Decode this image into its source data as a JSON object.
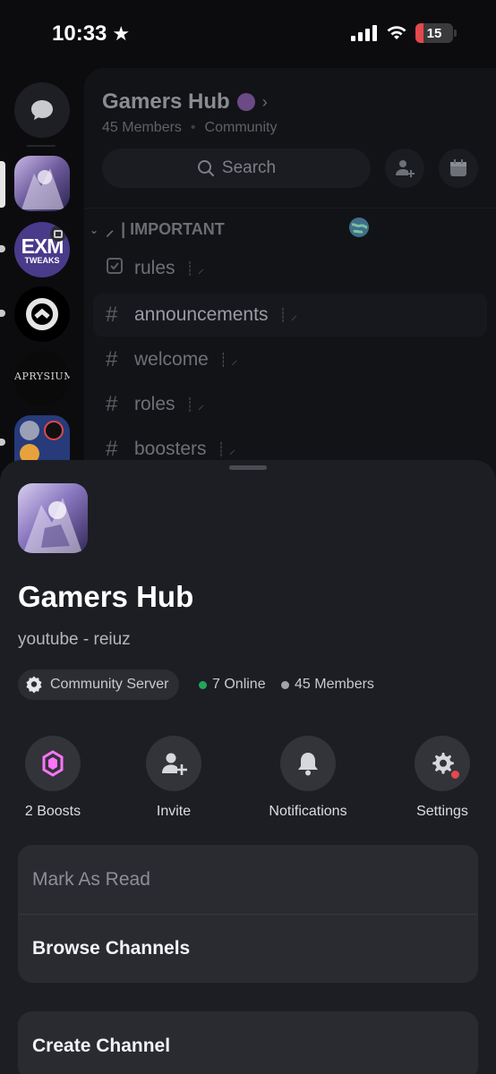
{
  "status_bar": {
    "time": "10:33",
    "star": "★",
    "battery": "15"
  },
  "server": {
    "name": "Gamers Hub",
    "members_short": "45 Members",
    "type": "Community",
    "description": "youtube - reiuz",
    "community_chip": "Community Server",
    "online": "7 Online",
    "members": "45 Members"
  },
  "panel": {
    "search_label": "Search",
    "category": "| IMPORTANT",
    "channels": [
      {
        "name": "rules"
      },
      {
        "name": "announcements"
      },
      {
        "name": "welcome"
      },
      {
        "name": "roles"
      },
      {
        "name": "boosters"
      }
    ]
  },
  "rail": {
    "servers": [
      "Gamers Hub",
      "EXM Tweaks",
      "Server 3",
      "Server 4",
      "Server folder"
    ],
    "exm_text_top": "EXM",
    "exm_text_bottom": "TWEAKS",
    "fourth_text": "APRYSIUM"
  },
  "actions": [
    {
      "label": "2 Boosts",
      "icon": "boost-gem-icon"
    },
    {
      "label": "Invite",
      "icon": "invite-person-add-icon"
    },
    {
      "label": "Notifications",
      "icon": "bell-icon"
    },
    {
      "label": "Settings",
      "icon": "gear-icon"
    }
  ],
  "menu": {
    "mark_as_read": "Mark As Read",
    "browse_channels": "Browse Channels",
    "create_channel": "Create Channel"
  },
  "colors": {
    "sheet_bg": "#1d1e23",
    "online_dot": "#23a55a",
    "member_dot": "#a1a3a8",
    "boost_pink": "#ff73fa",
    "alert_red": "#e5484d"
  }
}
